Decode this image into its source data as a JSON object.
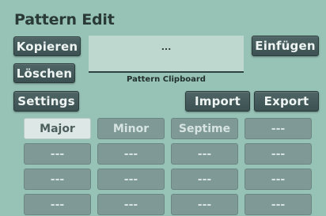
{
  "header": {
    "title": "Pattern Edit"
  },
  "toolbar": {
    "copy_label": "Kopieren",
    "delete_label": "Löschen",
    "settings_label": "Settings",
    "paste_label": "Einfügen",
    "import_label": "Import",
    "export_label": "Export"
  },
  "clipboard": {
    "value": "...",
    "label": "Pattern Clipboard"
  },
  "grid": {
    "cells": [
      "Major",
      "Minor",
      "Septime",
      "---",
      "---",
      "---",
      "---",
      "---",
      "---",
      "---",
      "---",
      "---",
      "---",
      "---",
      "---",
      "---"
    ],
    "active_index": 0
  },
  "colors": {
    "background": "#97c2b6",
    "button": "#435859",
    "cell": "#7f9a96",
    "cell_active": "#dde8e6"
  }
}
